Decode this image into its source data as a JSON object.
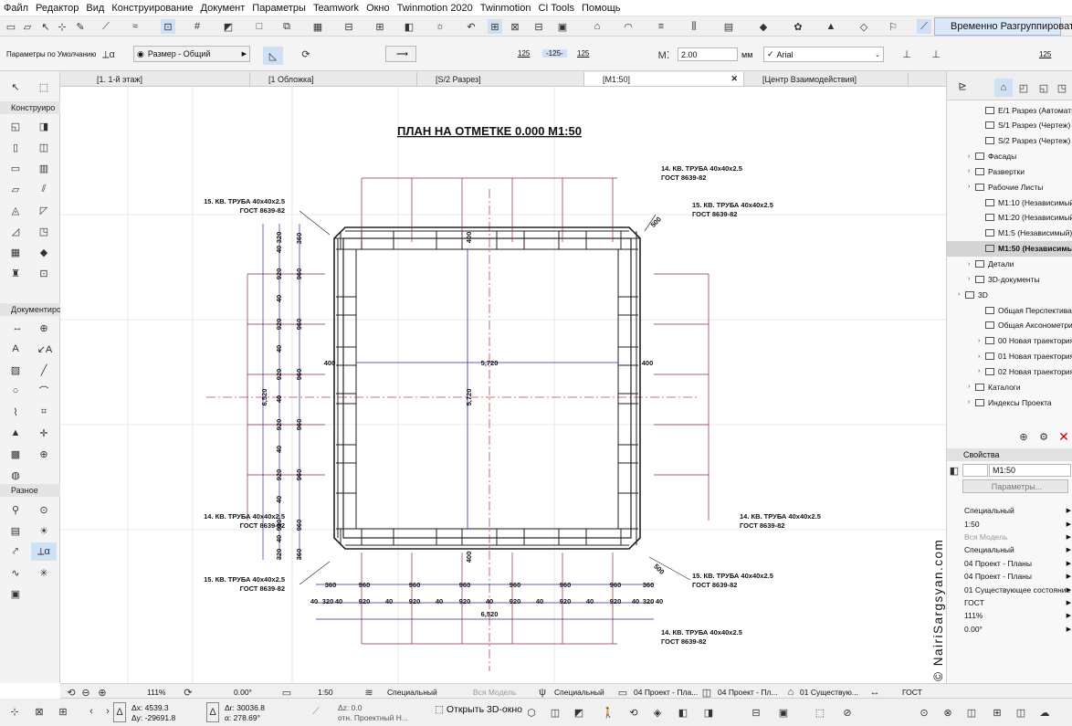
{
  "menu": [
    "Файл",
    "Редактор",
    "Вид",
    "Конструирование",
    "Документ",
    "Параметры",
    "Teamwork",
    "Окно",
    "Twinmotion 2020",
    "Twinmotion",
    "CI Tools",
    "Помощь"
  ],
  "toolbar": {
    "regroup_label": "Временно Разгруппировать",
    "defaults_label": "Параметры по Умолчанию",
    "dimension_style": "Размер - Общий",
    "height_value": "2.00",
    "height_unit": "мм",
    "font_name": "Arial",
    "scale_a": "125",
    "scale_b": "-125-",
    "scale_c": "125",
    "scale_d": "125"
  },
  "tabs": [
    {
      "label": "[1. 1-й этаж]"
    },
    {
      "label": "[1 Обложка]"
    },
    {
      "label": "[S/2 Разрез]"
    },
    {
      "label": "[M1:50]"
    },
    {
      "label": "[Центр Взаимодействия]"
    }
  ],
  "left_sections": {
    "construct": "Конструиро",
    "document": "Документиро",
    "misc": "Разное"
  },
  "drawing": {
    "title": "ПЛАН НА ОТМЕТКЕ 0.000  М1:50",
    "callouts": [
      {
        "l1": "14. КВ. ТРУБА 40х40х2.5",
        "l2": "ГОСТ 8639-82"
      },
      {
        "l1": "15. КВ. ТРУБА 40х40х2.5",
        "l2": "ГОСТ 8639-82"
      },
      {
        "l1": "15. КВ. ТРУБА 40х40х2.5",
        "l2": "ГОСТ 8639-82"
      },
      {
        "l1": "14. КВ. ТРУБА 40х40х2.5",
        "l2": "ГОСТ 8639-82"
      },
      {
        "l1": "14. КВ. ТРУБА 40х40х2.5",
        "l2": "ГОСТ 8639-82"
      },
      {
        "l1": "15. КВ. ТРУБА 40х40х2.5",
        "l2": "ГОСТ 8639-82"
      },
      {
        "l1": "15. КВ. ТРУБА 40х40х2.5",
        "l2": "ГОСТ 8639-82"
      },
      {
        "l1": "14. КВ. ТРУБА 40х40х2.5",
        "l2": "ГОСТ 8639-82"
      }
    ],
    "dims": {
      "overall": "6,520",
      "inner": "5,720",
      "side": "400",
      "diag": "500",
      "s40": "40",
      "s320": "320",
      "s360": "360",
      "s920": "920",
      "s960": "960"
    }
  },
  "navigator": {
    "items": [
      {
        "label": "E/1 Разрез (Автомати",
        "ind": 2,
        "sel": false
      },
      {
        "label": "S/1 Разрез (Чертеж)",
        "ind": 2,
        "sel": false
      },
      {
        "label": "S/2 Разрез (Чертеж)",
        "ind": 2,
        "sel": false
      },
      {
        "label": "Фасады",
        "ind": 1,
        "sel": false
      },
      {
        "label": "Развертки",
        "ind": 1,
        "sel": false
      },
      {
        "label": "Рабочие Листы",
        "ind": 1,
        "sel": false
      },
      {
        "label": "M1:10 (Независимый)",
        "ind": 2,
        "sel": false
      },
      {
        "label": "M1:20 (Независимый)",
        "ind": 2,
        "sel": false
      },
      {
        "label": "M1:5 (Независимый)",
        "ind": 2,
        "sel": false
      },
      {
        "label": "M1:50 (Независимы",
        "ind": 2,
        "sel": true
      },
      {
        "label": "Детали",
        "ind": 1,
        "sel": false
      },
      {
        "label": "3D-документы",
        "ind": 1,
        "sel": false
      },
      {
        "label": "3D",
        "ind": 0,
        "sel": false
      },
      {
        "label": "Общая Перспектива",
        "ind": 2,
        "sel": false
      },
      {
        "label": "Общая Аксонометри",
        "ind": 2,
        "sel": false
      },
      {
        "label": "00 Новая траектория",
        "ind": 2,
        "sel": false
      },
      {
        "label": "01 Новая траектория",
        "ind": 2,
        "sel": false
      },
      {
        "label": "02 Новая траектория",
        "ind": 2,
        "sel": false
      },
      {
        "label": "Каталоги",
        "ind": 1,
        "sel": false
      },
      {
        "label": "Индексы Проекта",
        "ind": 1,
        "sel": false
      }
    ],
    "properties_title": "Свойства",
    "name_value": "M1:50",
    "params_button": "Параметры...",
    "props": [
      "Специальный",
      "1:50",
      "Вся Модель",
      "Специальный",
      "04 Проект - Планы",
      "04 Проект - Планы",
      "01 Существующее состояние",
      "ГОСТ",
      "111%",
      "0.00°"
    ]
  },
  "status": {
    "zoom": "111%",
    "angle": "0.00°",
    "scale": "1:50",
    "layer_combo": "Специальный",
    "model": "Вся Модель",
    "pen_set": "Специальный",
    "mvo": "04 Проект - Пла...",
    "graphic": "04 Проект - Пл...",
    "renovation": "01 Существую...",
    "dim_std": "ГОСТ"
  },
  "coords": {
    "dx": "Δx: 4539.3",
    "dy": "Δy: -29691.8",
    "dr": "Δr: 30036.8",
    "da": "α: 278.69°",
    "dz": "Δz: 0.0",
    "ref": "отн. Проектный Н..."
  },
  "open3d": "Открыть 3D-окно",
  "watermark": "© NairiSargsyan.com"
}
